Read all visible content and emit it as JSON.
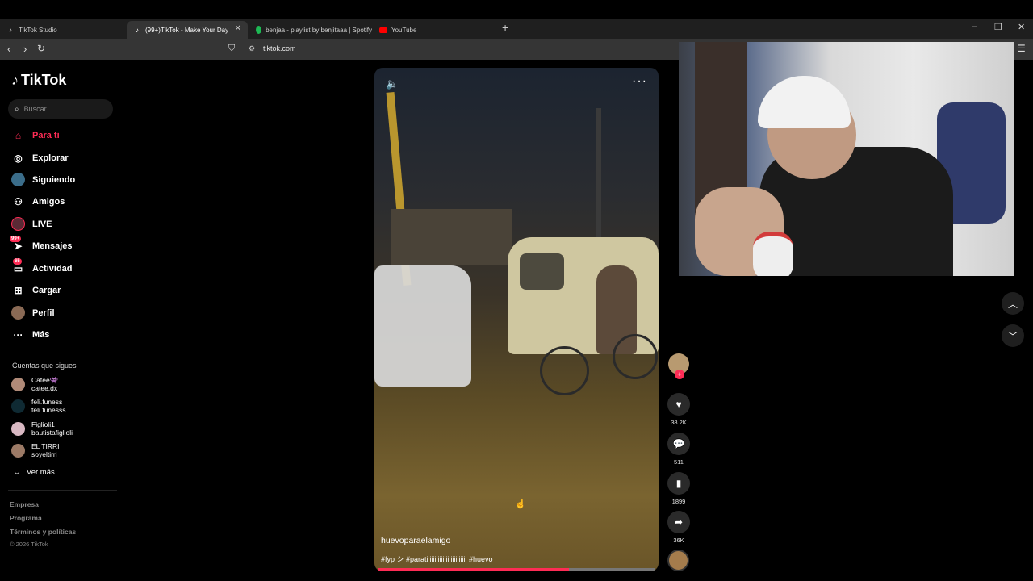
{
  "browser": {
    "tabs": [
      {
        "label": "TikTok Studio"
      },
      {
        "label": "(99+)TikTok - Make Your Day"
      },
      {
        "label": "benjaa - playlist by benjitaaa | Spotify"
      },
      {
        "label": "YouTube"
      }
    ],
    "url": "tiktok.com"
  },
  "sidebar": {
    "logo": "TikTok",
    "search_placeholder": "Buscar",
    "nav": [
      {
        "label": "Para ti"
      },
      {
        "label": "Explorar"
      },
      {
        "label": "Siguiendo"
      },
      {
        "label": "Amigos"
      },
      {
        "label": "LIVE"
      },
      {
        "label": "Mensajes",
        "badge": "99+"
      },
      {
        "label": "Actividad",
        "badge": "65"
      },
      {
        "label": "Cargar"
      },
      {
        "label": "Perfil"
      },
      {
        "label": "Más"
      }
    ],
    "following_title": "Cuentas que sigues",
    "following": [
      {
        "name": "Catee👾",
        "handle": "catee.dx"
      },
      {
        "name": "feli.funess",
        "handle": "feli.funesss"
      },
      {
        "name": "Figlioli1",
        "handle": "bautistafiglioli"
      },
      {
        "name": "EL TIRRI",
        "handle": "soyeltirri"
      }
    ],
    "see_more": "Ver más",
    "footer": [
      "Empresa",
      "Programa",
      "Términos y políticas"
    ],
    "copyright": "© 2026 TikTok"
  },
  "video": {
    "title": "huevoparaelamigo",
    "tags": "#fyp シ #paratiiiiiiiiiiiiiiiiiiiiiiiii #huevo",
    "progress": 0.69
  },
  "actions": {
    "likes": "38.2K",
    "comments": "511",
    "saves": "1899",
    "shares": "36K"
  }
}
